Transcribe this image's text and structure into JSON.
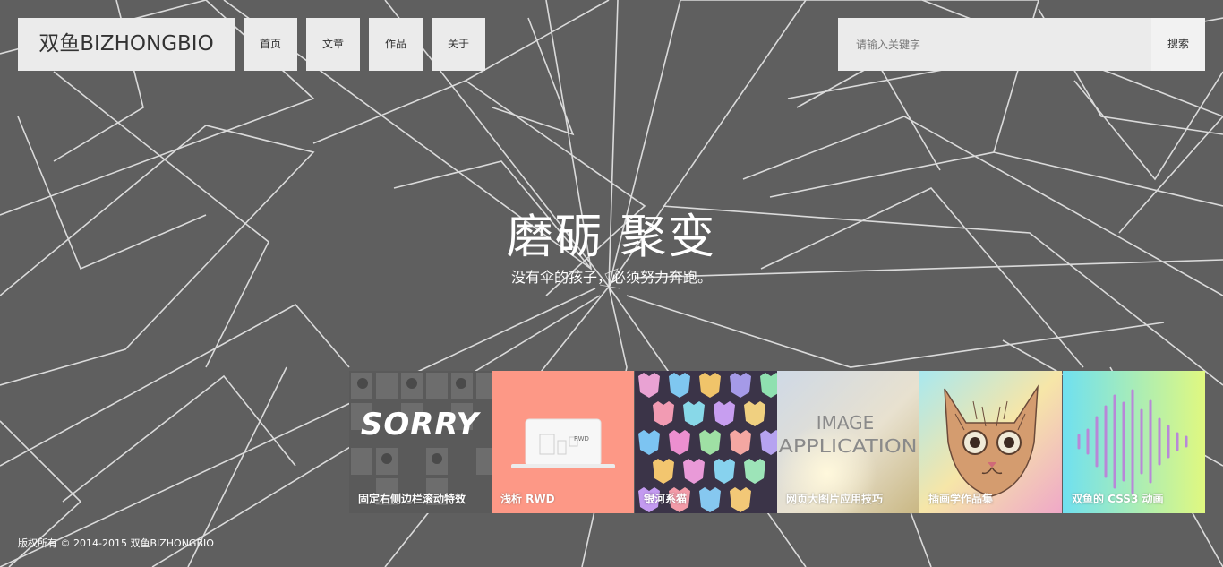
{
  "site": {
    "logo": "双鱼BIZHONGBIO",
    "nav": [
      {
        "label": "首页"
      },
      {
        "label": "文章"
      },
      {
        "label": "作品"
      },
      {
        "label": "关于"
      }
    ],
    "search": {
      "placeholder": "请输入关键字",
      "value": "",
      "button": "搜索"
    }
  },
  "hero": {
    "title": "磨砺 聚变",
    "subtitle": "没有伞的孩子，必须努力奔跑。"
  },
  "cards": [
    {
      "title": "固定右侧边栏滚动特效",
      "art_text": "SORRY",
      "icon": "photo-grid-thumbnail"
    },
    {
      "title": "浅析 RWD",
      "art_text": "RWD",
      "icon": "laptop-rwd-thumbnail",
      "accent": "#fd9886"
    },
    {
      "title": "银河系猫",
      "icon": "galaxy-cats-thumbnail"
    },
    {
      "title": "网页大图片应用技巧",
      "art_text_line1": "IMAGE",
      "art_text_line2": "APPLICATION",
      "icon": "image-application-thumbnail"
    },
    {
      "title": "插画学作品集",
      "icon": "cat-illustration-thumbnail"
    },
    {
      "title": "双鱼的 CSS3 动画",
      "icon": "sound-wave-thumbnail"
    }
  ],
  "footer": {
    "copyright": "版权所有 © 2014-2015 双鱼BIZHONGBIO"
  },
  "colors": {
    "background": "#5f5f5f",
    "panel": "#ebebeb",
    "rwd_card": "#fd9886"
  }
}
